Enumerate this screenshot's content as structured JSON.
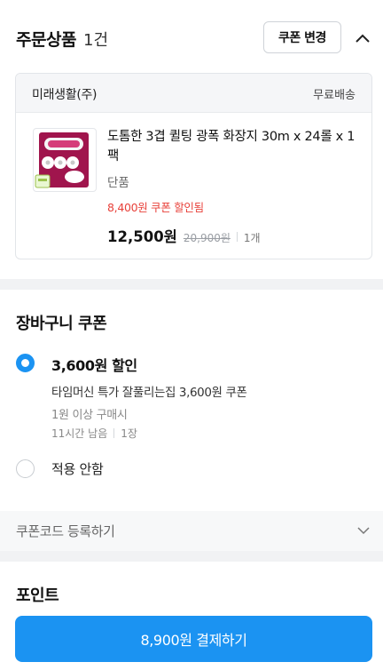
{
  "order": {
    "title": "주문상품",
    "count": "1건",
    "coupon_change_label": "쿠폰 변경"
  },
  "product_card": {
    "seller": "미래생활(주)",
    "shipping": "무료배송",
    "name": "도톰한 3겹 퀼팅 광폭 화장지 30m x 24롤 x 1팩",
    "option": "단품",
    "discount_text": "8,400원 쿠폰 할인됨",
    "price": "12,500원",
    "original_price": "20,900원",
    "quantity": "1개"
  },
  "cart_coupon": {
    "title": "장바구니 쿠폰",
    "selected_coupon": {
      "amount_label": "3,600원 할인",
      "name": "타임머신 특가 잘풀리는집 3,600원 쿠폰",
      "condition": "1원 이상 구매시",
      "time_left": "11시간 남음",
      "count": "1장"
    },
    "no_apply_label": "적용 안함"
  },
  "coupon_code": {
    "label": "쿠폰코드 등록하기"
  },
  "points": {
    "title": "포인트"
  },
  "checkout": {
    "pay_label": "8,900원 결제하기"
  },
  "colors": {
    "accent": "#1b93f2",
    "discount_red": "#e8413a",
    "section_gap": "#f1f2f4"
  }
}
